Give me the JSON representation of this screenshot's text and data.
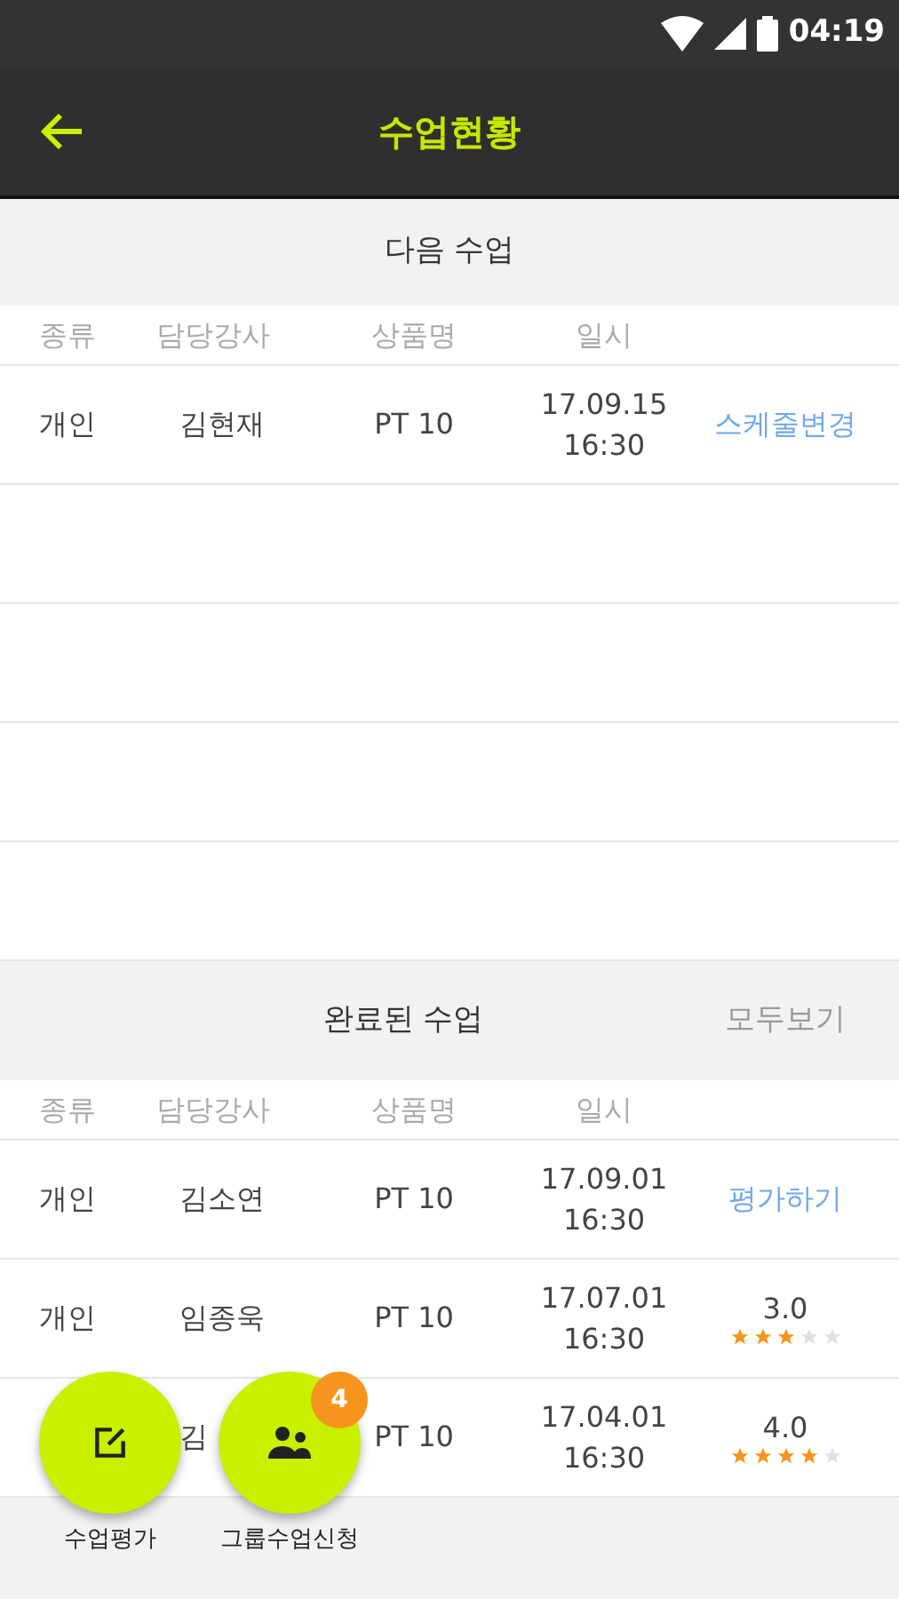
{
  "status_bar": {
    "time": "04:19"
  },
  "toolbar": {
    "title": "수업현황"
  },
  "upcoming": {
    "title": "다음 수업",
    "columns": [
      "종류",
      "담당강사",
      "상품명",
      "일시"
    ],
    "rows": [
      {
        "type": "개인",
        "instructor": "김현재",
        "product": "PT 10",
        "date": "17.09.15",
        "time": "16:30",
        "kind": "action",
        "action": "스케줄변경"
      }
    ]
  },
  "completed": {
    "title": "완료된 수업",
    "view_all": "모두보기",
    "columns": [
      "종류",
      "담당강사",
      "상품명",
      "일시"
    ],
    "rows": [
      {
        "type": "개인",
        "instructor": "김소연",
        "product": "PT 10",
        "date": "17.09.01",
        "time": "16:30",
        "kind": "action",
        "action": "평가하기"
      },
      {
        "type": "개인",
        "instructor": "임종욱",
        "product": "PT 10",
        "date": "17.07.01",
        "time": "16:30",
        "kind": "rating",
        "score": "3.0",
        "stars": 3
      },
      {
        "instructor": "김",
        "product": "PT 10",
        "date": "17.04.01",
        "time": "16:30",
        "kind": "rating",
        "score": "4.0",
        "stars": 4
      }
    ]
  },
  "fabs": [
    {
      "kind": "review",
      "label": "수업평가"
    },
    {
      "kind": "group",
      "label": "그룹수업신청",
      "badge": "4"
    }
  ]
}
